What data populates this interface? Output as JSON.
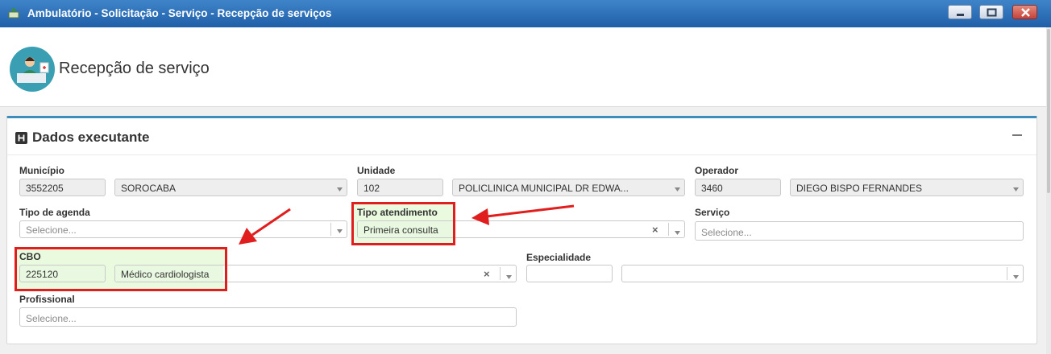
{
  "window": {
    "title": "Ambulatório - Solicitação - Serviço - Recepção de serviços"
  },
  "header": {
    "title": "Recepção de serviço"
  },
  "panel": {
    "title": "Dados executante",
    "fields": {
      "municipio": {
        "label": "Município",
        "code": "3552205",
        "name": "SOROCABA"
      },
      "unidade": {
        "label": "Unidade",
        "code": "102",
        "name": "POLICLINICA MUNICIPAL DR EDWA..."
      },
      "operador": {
        "label": "Operador",
        "code": "3460",
        "name": "DIEGO BISPO FERNANDES"
      },
      "tipo_agenda": {
        "label": "Tipo de agenda",
        "placeholder": "Selecione..."
      },
      "tipo_atendimento": {
        "label": "Tipo atendimento",
        "value": "Primeira consulta"
      },
      "servico": {
        "label": "Serviço",
        "placeholder": "Selecione..."
      },
      "cbo": {
        "label": "CBO",
        "code": "225120",
        "name": "Médico cardiologista"
      },
      "especialidade": {
        "label": "Especialidade",
        "code": "",
        "name": ""
      },
      "profissional": {
        "label": "Profissional",
        "placeholder": "Selecione..."
      }
    }
  },
  "colors": {
    "titlebar": "#2a6fb8",
    "accent": "#3c8dbc",
    "highlight": "#e01e1e",
    "selected_bg": "#e9f8e0"
  }
}
